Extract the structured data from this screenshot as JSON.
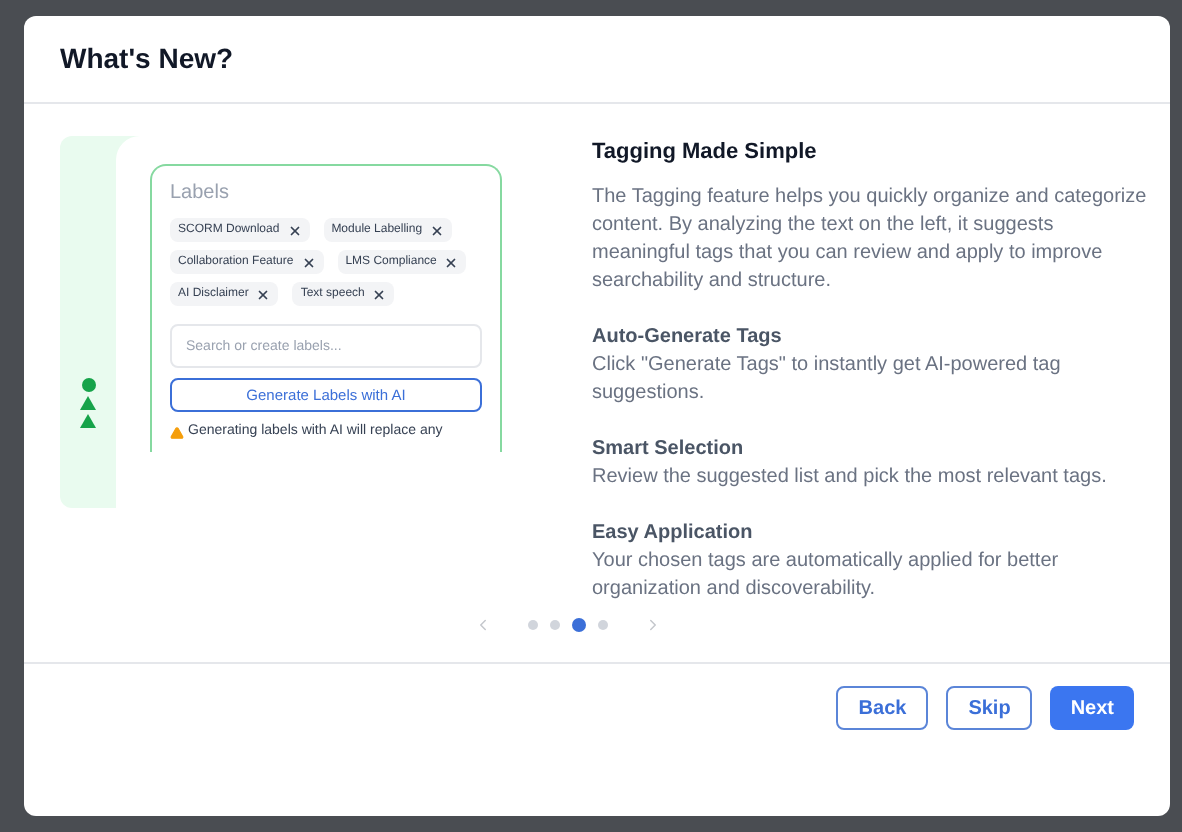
{
  "dialog": {
    "title": "What's New?"
  },
  "preview": {
    "heading": "Labels",
    "tags": [
      {
        "label": "SCORM Download"
      },
      {
        "label": "Module Labelling"
      },
      {
        "label": "Collaboration Feature"
      },
      {
        "label": "LMS Compliance"
      },
      {
        "label": "AI Disclaimer"
      },
      {
        "label": "Text speech"
      }
    ],
    "search_placeholder": "Search or create labels...",
    "generate_button": "Generate Labels with AI",
    "warning": "Generating labels with AI will replace any"
  },
  "article": {
    "title": "Tagging Made Simple",
    "intro": "The Tagging feature helps you quickly organize and categorize content. By analyzing the text on the left, it suggests meaningful tags that you can review and apply to improve searchability and structure.",
    "sections": [
      {
        "heading": "Auto-Generate Tags",
        "text": "Click \"Generate Tags\" to instantly get AI-powered tag suggestions."
      },
      {
        "heading": "Smart Selection",
        "text": "Review the suggested list and pick the most relevant tags."
      },
      {
        "heading": "Easy Application",
        "text": "Your chosen tags are automatically applied for better organization and discoverability."
      }
    ]
  },
  "pager": {
    "dots": [
      {
        "selected": false
      },
      {
        "selected": false
      },
      {
        "selected": true
      },
      {
        "selected": false
      }
    ]
  },
  "buttons": [
    {
      "label": "Back",
      "kind": "outline"
    },
    {
      "label": "Skip",
      "kind": "outline"
    },
    {
      "label": "Next",
      "kind": "primary"
    }
  ]
}
